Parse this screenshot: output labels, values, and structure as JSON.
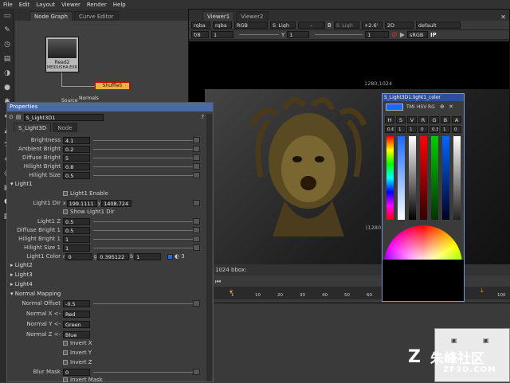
{
  "menu": [
    "File",
    "Edit",
    "Layout",
    "Viewer",
    "Render",
    "Help"
  ],
  "node_graph": {
    "tabs": [
      "Node Graph",
      "Curve Editor"
    ],
    "nodes": {
      "read": "Read2",
      "read_file": "MEIDUSHA.EXR",
      "shuffle": "Shuffle5",
      "normals": "Normals",
      "source": "Source"
    }
  },
  "viewer": {
    "tabs": [
      "Viewer1",
      "Viewer2"
    ],
    "row1": {
      "channels": "rgba",
      "channel2": "rgba",
      "rgb": "RGB",
      "layer_a": "S_Ligh",
      "dash": "-",
      "b_label": "B",
      "layer_b": "S_Ligh",
      "gain": "+2.6'",
      "mode": "2D",
      "lut": "default"
    },
    "row2": {
      "scale": "f/8",
      "value1": "1",
      "y_label": "Y",
      "value2": "1",
      "frame": "1",
      "lut2": "sRGB",
      "ip": "IP"
    },
    "format_top": "1280,1024",
    "format_side": "(1280",
    "bbox_label": "1024 bbox:"
  },
  "properties": {
    "title": "Properties",
    "node_name": "S_Light3D1",
    "tabs": [
      "S_Light3D",
      "Node"
    ],
    "params": [
      {
        "label": "Brightness",
        "value": "4.1"
      },
      {
        "label": "Ambient Bright",
        "value": "0.2"
      },
      {
        "label": "Diffuse Bright",
        "value": "5"
      },
      {
        "label": "Hilight Bright",
        "value": "0.8"
      },
      {
        "label": "Hilight Size",
        "value": "0.5"
      }
    ],
    "light1": {
      "section": "Light1",
      "enable": "Light1 Enable",
      "dir_label": "Light1 Dir",
      "dir_x": "199.1111",
      "dir_y": "1408.724",
      "show_dir": "Show Light1 Dir",
      "params": [
        {
          "label": "Light1 Z",
          "value": "0.5"
        },
        {
          "label": "Diffuse Bright 1",
          "value": "0.5"
        },
        {
          "label": "Hilight Bright 1",
          "value": "1"
        },
        {
          "label": "Hilight Size 1",
          "value": "1"
        }
      ],
      "color_label": "Light1 Color",
      "color_r": "0",
      "color_g": "0.395122",
      "color_b": "1",
      "color_count": "3"
    },
    "sections": [
      "Light2",
      "Light3",
      "Light4",
      "Normal Mapping"
    ],
    "normal_offset_label": "Normal Offset",
    "normal_offset_value": "-0.5",
    "normal_axes": [
      {
        "label": "Normal X <-",
        "value": "Red"
      },
      {
        "label": "Normal Y <-",
        "value": "Green"
      },
      {
        "label": "Normal Z <-",
        "value": "Blue"
      }
    ],
    "inverts": [
      "Invert X",
      "Invert Y",
      "Invert Z"
    ],
    "blur_mask_label": "Blur Mask",
    "blur_mask_value": "0",
    "invert_mask": "Invert Mask"
  },
  "picker": {
    "title": "S_Light3D1.light1_color",
    "tmi": "TMI",
    "hsv": "HSV",
    "rg": "RG",
    "channels": [
      "H",
      "S",
      "V",
      "R",
      "G",
      "B",
      "A"
    ],
    "values": [
      "0.6",
      "1",
      "1",
      "0",
      "0.3",
      "1",
      "0"
    ]
  },
  "timeline": {
    "start": "1",
    "marks": [
      "10",
      "20",
      "30",
      "40",
      "50",
      "60",
      "70",
      "80",
      "90",
      "100"
    ],
    "end": "100"
  },
  "watermark": {
    "brand": "朱峰社区",
    "url": "ZF3D.COM"
  },
  "colors": {
    "accent": "#4a6aa5",
    "shuffle_node": "#f0b040",
    "read_node": "#b8b8b8"
  }
}
